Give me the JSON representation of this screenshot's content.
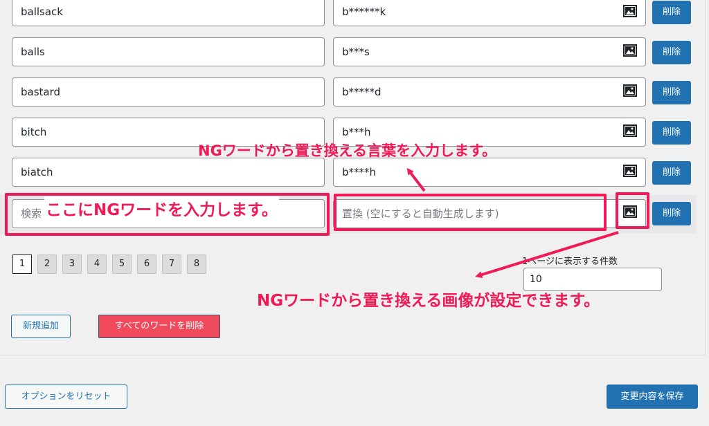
{
  "rows": [
    {
      "word": "ballsack",
      "replacement": "b******k",
      "delete_label": "削除"
    },
    {
      "word": "balls",
      "replacement": "b***s",
      "delete_label": "削除"
    },
    {
      "word": "bastard",
      "replacement": "b*****d",
      "delete_label": "削除"
    },
    {
      "word": "bitch",
      "replacement": "b***h",
      "delete_label": "削除"
    },
    {
      "word": "biatch",
      "replacement": "b****h",
      "delete_label": "削除"
    }
  ],
  "new_row": {
    "word_placeholder": "検索",
    "replacement_placeholder": "置換 (空にすると自動生成します)",
    "delete_label": "削除"
  },
  "pagination": {
    "pages": [
      "1",
      "2",
      "3",
      "4",
      "5",
      "6",
      "7",
      "8"
    ],
    "current": "1"
  },
  "per_page": {
    "label": "1ページに表示する件数",
    "value": "10"
  },
  "buttons": {
    "add_new": "新規追加",
    "delete_all": "すべてのワードを削除",
    "reset_options": "オプションをリセット",
    "save_changes": "変更内容を保存"
  },
  "annotations": {
    "word_input_note": "ここにNGワードを入力します。",
    "replacement_note": "NGワードから置き換える言葉を入力します。",
    "image_note": "NGワードから置き換える画像が設定できます。"
  },
  "icons": {
    "image_button": "image-icon"
  },
  "colors": {
    "accent": "#2271b1",
    "annotation": "#f01a56",
    "danger": "#f04b5c"
  }
}
